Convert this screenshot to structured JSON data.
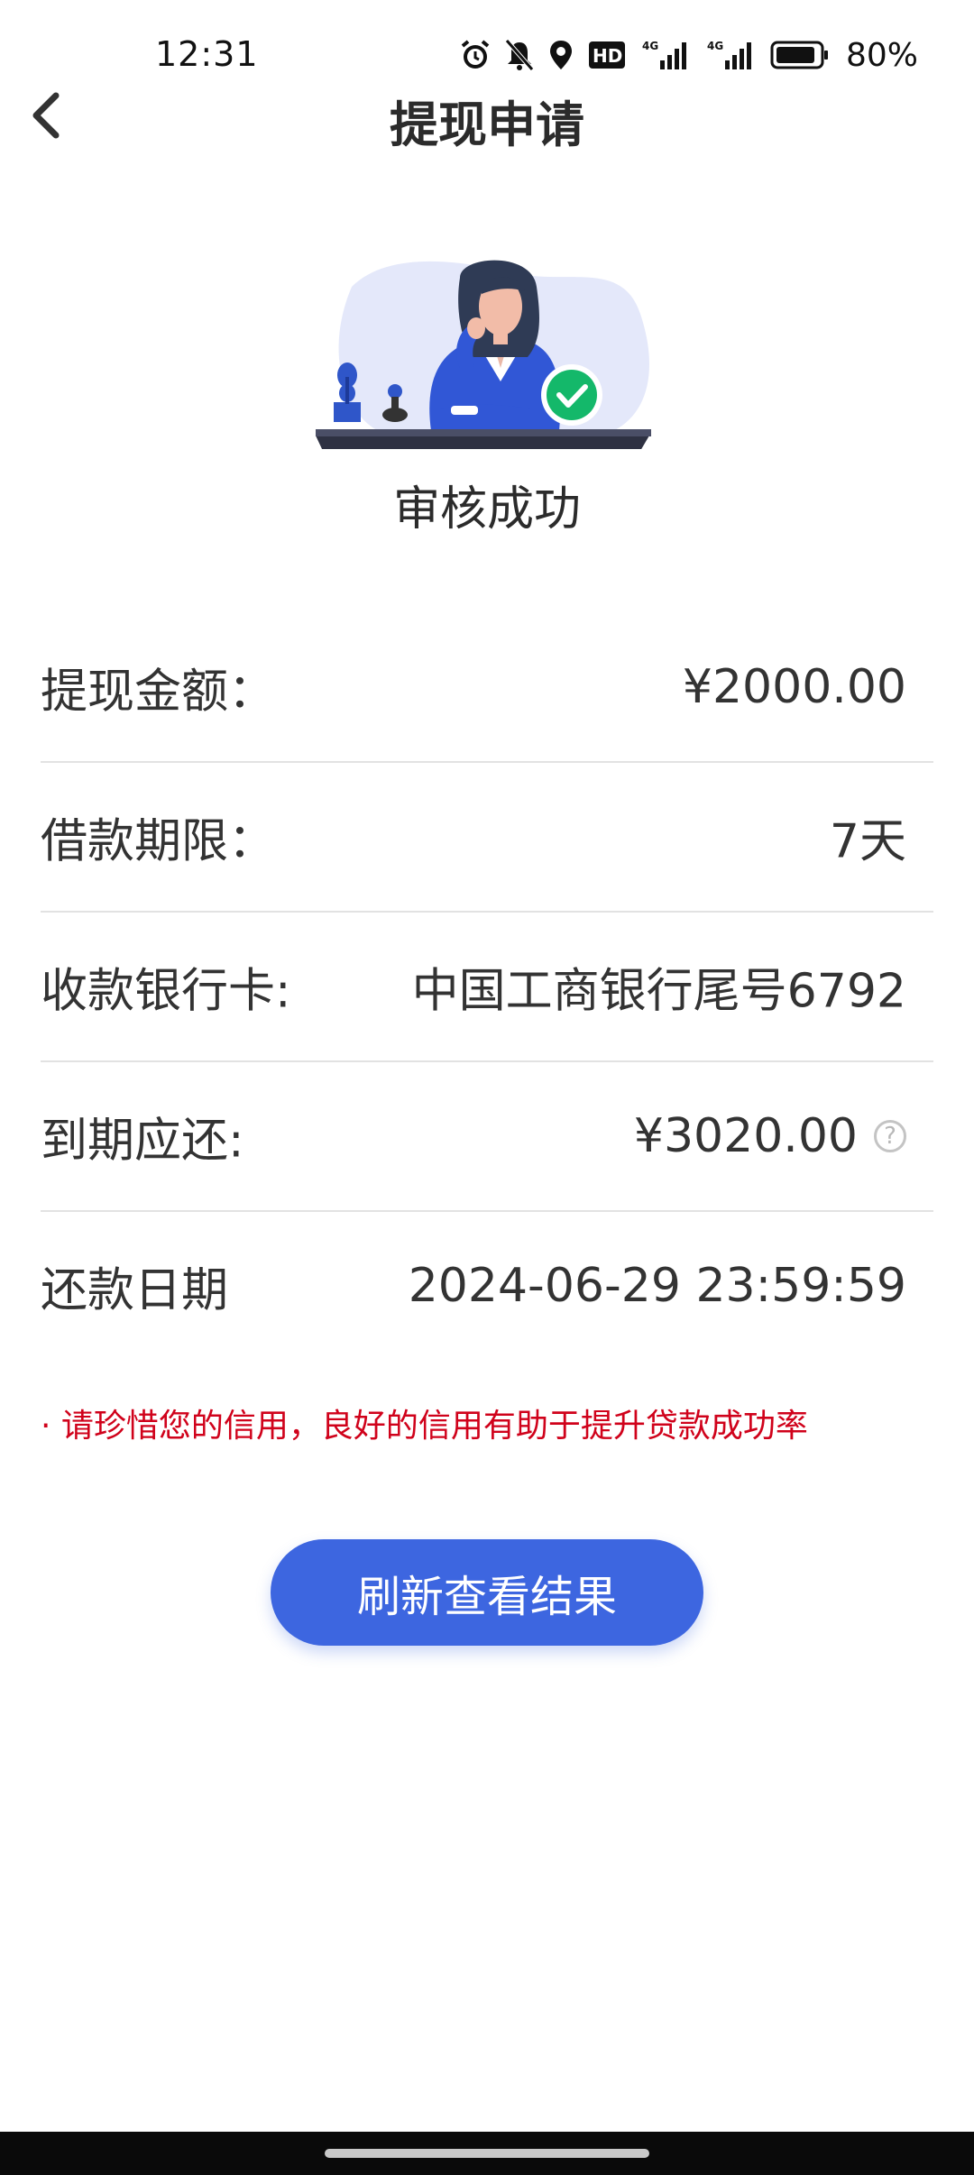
{
  "status_bar": {
    "time": "12:31",
    "battery": "80%",
    "icons": [
      "alarm-icon",
      "bell-off-icon",
      "location-icon",
      "hd-icon",
      "signal-4g-icon",
      "signal-4g-icon",
      "battery-icon"
    ]
  },
  "header": {
    "title": "提现申请",
    "back_icon": "chevron-left-icon"
  },
  "result": {
    "illustration": "woman-at-desk-success-illustration",
    "heading": "审核成功"
  },
  "details": [
    {
      "label": "提现金额：",
      "value": "¥2000.00"
    },
    {
      "label": "借款期限：",
      "value": "7天"
    },
    {
      "label": "收款银行卡:",
      "value": "中国工商银行尾号6792"
    },
    {
      "label": "到期应还:",
      "value": "¥3020.00"
    },
    {
      "label": "还款日期",
      "value": "2024-06-29 23:59:59"
    }
  ],
  "notice": "· 请珍惜您的信用，良好的信用有助于提升贷款成功率",
  "actions": {
    "refresh_label": "刷新查看结果"
  },
  "colors": {
    "accent": "#3d66e0",
    "notice": "#d0021b",
    "success": "#14b86a"
  }
}
